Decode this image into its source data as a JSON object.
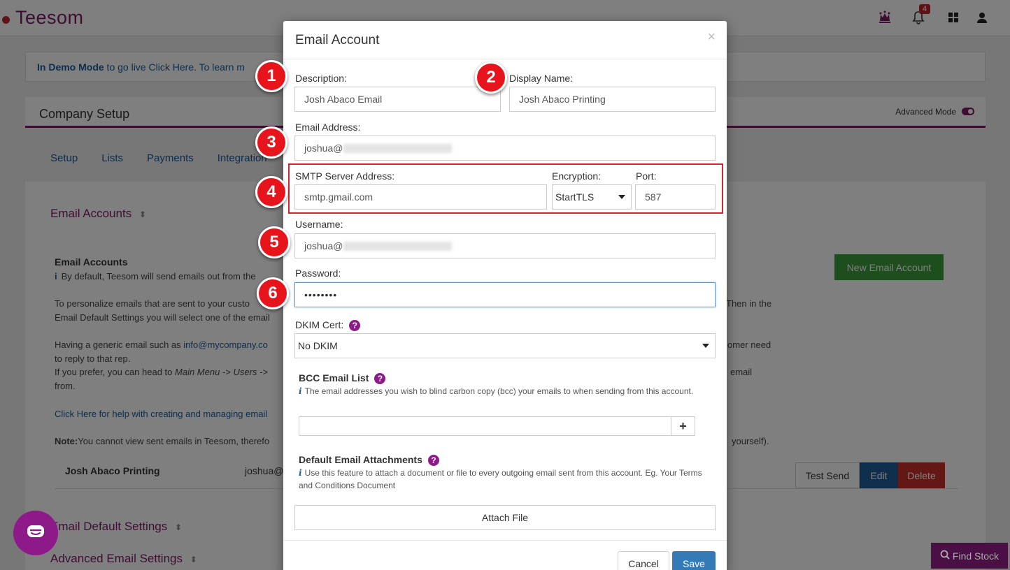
{
  "app": {
    "logo_text": "Teesom",
    "notification_count": "4"
  },
  "background": {
    "demo_bold": "In Demo Mode",
    "demo_text": " to go live Click Here. To learn m",
    "company_setup_title": "Company Setup",
    "advanced_mode_label": "Advanced Mode",
    "tabs": [
      "Setup",
      "Lists",
      "Payments",
      "Integration"
    ],
    "email_accounts_section": "Email Accounts",
    "email_accounts_heading": "Email Accounts",
    "default_text": "By default, Teesom will send emails out from the",
    "personalize_text": "To personalize emails that are sent to your custo",
    "then_in_the": "Then in the",
    "email_default_text": "Email Default Settings you will select one of the email",
    "generic_text": "Having a generic email such as",
    "generic_link": "info@mycompany.co",
    "customer_need": "omer need",
    "reply_text": "to reply to that rep.",
    "prefer_text": "If you prefer, you can head to",
    "prefer_path": "Main Menu -> Users ->",
    "email_right": "email",
    "from_text": "from.",
    "click_here_help": "Click Here for help with creating and managing email",
    "note_label": "Note:",
    "note_text": "You cannot view sent emails in Teesom, therefo",
    "yourself_text": "yourself).",
    "account_row_name": "Josh Abaco Printing",
    "account_row_email": "joshua@",
    "new_email_button": "New Email Account",
    "test_send_button": "Test Send",
    "edit_button": "Edit",
    "delete_button": "Delete",
    "email_default_settings": "Email Default Settings",
    "advanced_email_settings": "Advanced Email Settings",
    "find_stock_button": "Find Stock"
  },
  "modal": {
    "title": "Email Account",
    "close_symbol": "×",
    "description_label": "Description:",
    "description_value": "Josh Abaco Email",
    "display_name_label": "Display Name:",
    "display_name_value": "Josh Abaco Printing",
    "email_address_label": "Email Address:",
    "email_address_value": "joshua@",
    "smtp_label": "SMTP Server Address:",
    "smtp_value": "smtp.gmail.com",
    "encryption_label": "Encryption:",
    "encryption_value": "StartTLS",
    "port_label": "Port:",
    "port_value": "587",
    "username_label": "Username:",
    "username_value": "joshua@",
    "password_label": "Password:",
    "password_value": "••••••••",
    "dkim_label": "DKIM Cert:",
    "dkim_value": "No DKIM",
    "bcc_title": "BCC Email List",
    "bcc_info": "The email addresses you wish to blind carbon copy (bcc) your emails to when sending from this account.",
    "bcc_add_symbol": "+",
    "attachments_title": "Default Email Attachments",
    "attachments_info": "Use this feature to attach a document or file to every outgoing email sent from this account. Eg. Your Terms and Conditions Document",
    "attach_file_button": "Attach File",
    "cancel_button": "Cancel",
    "save_button": "Save",
    "help_symbol": "?",
    "info_symbol": "i"
  },
  "callouts": [
    "1",
    "2",
    "3",
    "4",
    "5",
    "6"
  ],
  "colors": {
    "brand_purple": "#7b1c63",
    "callout_red": "#e8141c",
    "save_blue": "#337ab7",
    "highlight_border": "#d9232d"
  },
  "icons": [
    "crown-icon",
    "bell-icon",
    "grid-icon",
    "user-icon",
    "chat-icon",
    "search-icon",
    "sort-icon",
    "info-icon",
    "help-icon",
    "plus-icon",
    "caret-down-icon",
    "close-icon"
  ]
}
